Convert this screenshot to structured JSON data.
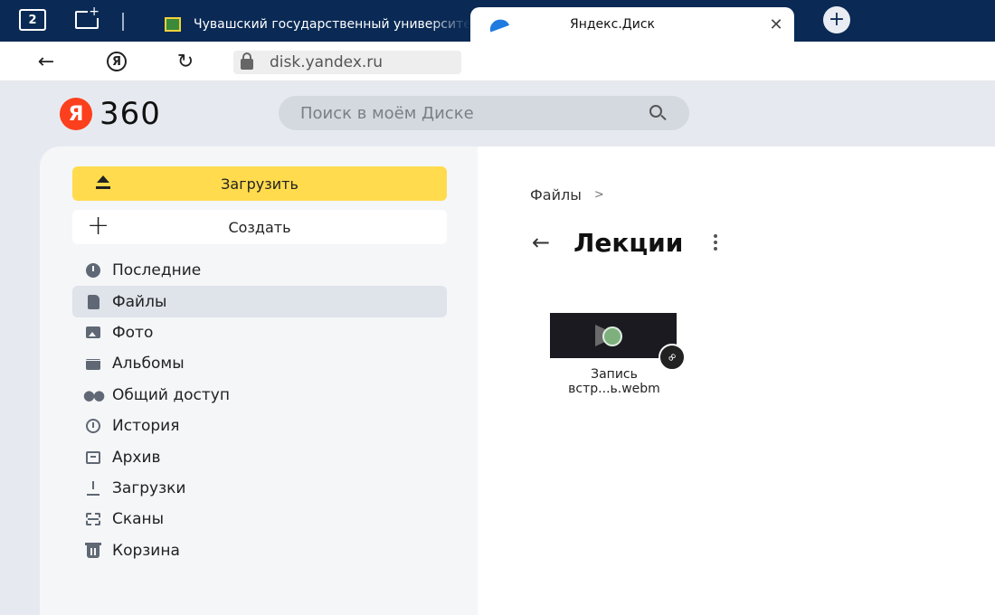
{
  "browser": {
    "tab_count": "2",
    "tabs": [
      {
        "title": "Чувашский государственный университет",
        "active": false
      },
      {
        "title": "Яндекс.Диск",
        "active": true
      }
    ],
    "close_glyph": "✕",
    "new_tab_glyph": "+",
    "address": {
      "url": "disk.yandex.ru"
    }
  },
  "header": {
    "logo_letter": "Я",
    "brand": "360",
    "search": {
      "placeholder": "Поиск в моём Диске",
      "value": ""
    }
  },
  "sidebar": {
    "upload_label": "Загрузить",
    "create_label": "Создать",
    "items": [
      {
        "label": "Последние",
        "icon": "clock-icon"
      },
      {
        "label": "Файлы",
        "icon": "file-icon",
        "active": true
      },
      {
        "label": "Фото",
        "icon": "photo-icon"
      },
      {
        "label": "Альбомы",
        "icon": "album-icon"
      },
      {
        "label": "Общий доступ",
        "icon": "shared-users-icon"
      },
      {
        "label": "История",
        "icon": "history-icon"
      },
      {
        "label": "Архив",
        "icon": "archive-icon"
      },
      {
        "label": "Загрузки",
        "icon": "download-icon"
      },
      {
        "label": "Сканы",
        "icon": "scan-icon"
      },
      {
        "label": "Корзина",
        "icon": "trash-icon"
      }
    ]
  },
  "main": {
    "breadcrumb": {
      "root": "Файлы",
      "separator": ">"
    },
    "folder_title": "Лекции",
    "files": [
      {
        "name_line1": "Запись",
        "name_line2": "встр...ь.webm",
        "type": "video",
        "shared_link": true
      }
    ]
  },
  "colors": {
    "tab_strip": "#0a2a55",
    "upload_button": "#ffdb4d",
    "yandex_red": "#fc3f1d",
    "header_bg": "#e6eaf0"
  }
}
